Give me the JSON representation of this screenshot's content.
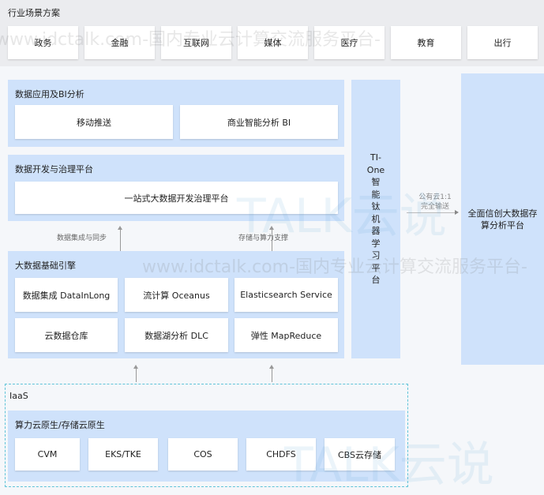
{
  "industry": {
    "title": "行业场景方案",
    "items": [
      "政务",
      "金融",
      "互联网",
      "媒体",
      "医疗",
      "教育",
      "出行"
    ]
  },
  "bi": {
    "title": "数据应用及BI分析",
    "items": [
      "移动推送",
      "商业智能分析 BI"
    ]
  },
  "dev": {
    "title": "数据开发与治理平台",
    "items": [
      "一站式大数据开发治理平台"
    ]
  },
  "links": {
    "left": "数据集成与同步",
    "right": "存储与算力支撑",
    "cloud_line1": "公有云1:1",
    "cloud_line2": "完全输送"
  },
  "engine": {
    "title": "大数据基础引擎",
    "items": [
      "数据集成 DataInLong",
      "流计算 Oceanus",
      "Elasticsearch Service",
      "云数据仓库",
      "数据湖分析 DLC",
      "弹性 MapReduce"
    ]
  },
  "ti": {
    "label": "TI-One智能钛机器学习平台",
    "chars": [
      "TI-",
      "One",
      "智",
      "能",
      "钛",
      "机",
      "器",
      "学",
      "习",
      "平",
      "台"
    ]
  },
  "right": {
    "label": "全面信创大数据存算分析平台"
  },
  "iaas": {
    "title": "IaaS",
    "sub": "算力云原生/存储云原生",
    "items": [
      "CVM",
      "EKS/TKE",
      "COS",
      "CHDFS",
      "CBS云存储"
    ]
  },
  "watermark": {
    "text1": "www.idctalk.com-国内专业云计算交流服务平台-",
    "logo": "TALK云说"
  },
  "colors": {
    "panel": "#cfe2fb",
    "band": "#ebecef",
    "dashed": "#5fc3d8"
  }
}
